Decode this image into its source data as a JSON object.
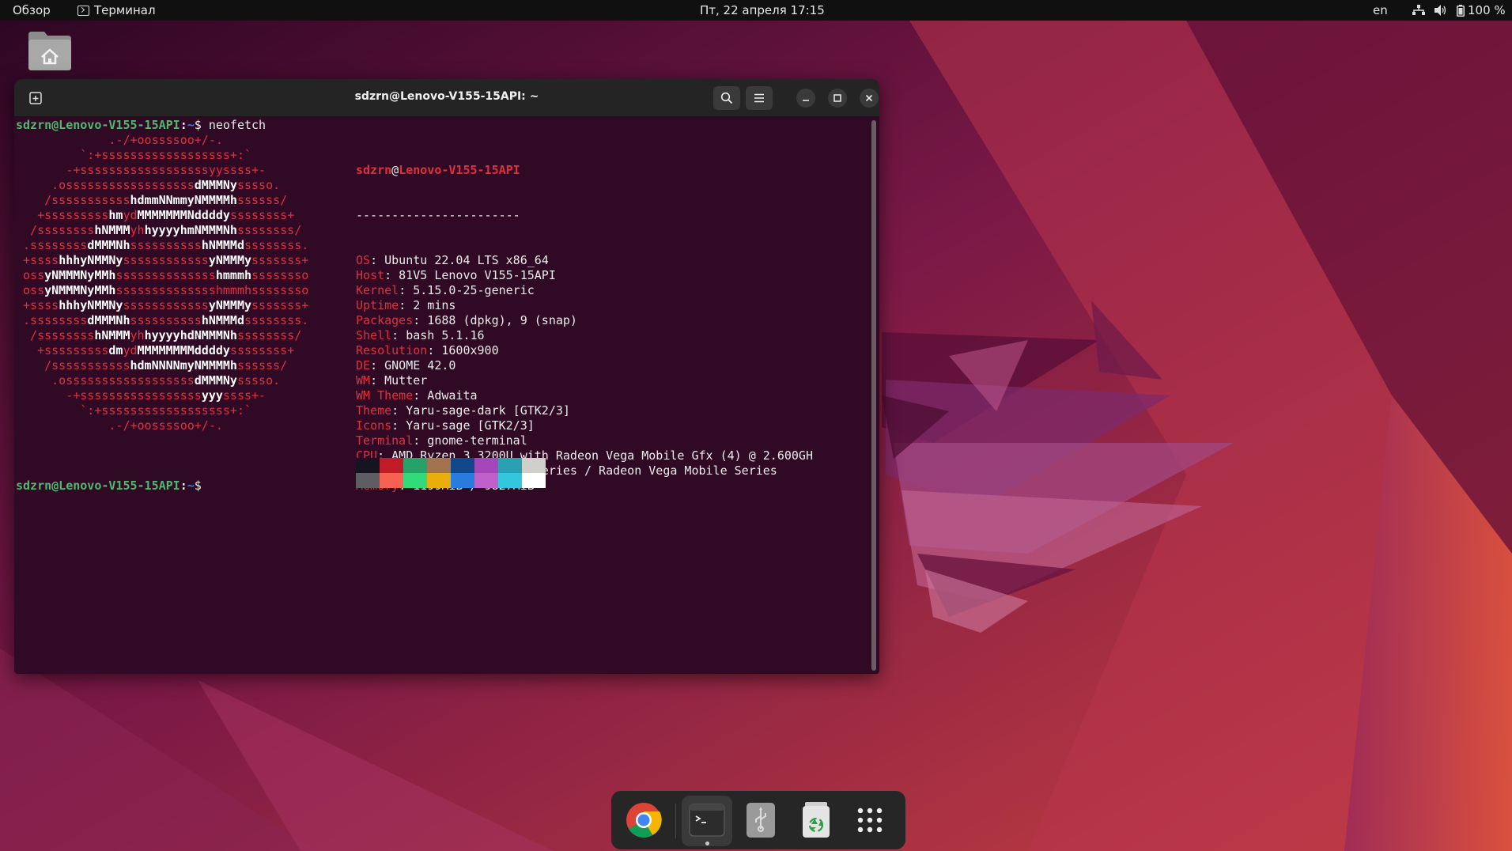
{
  "topbar": {
    "activities": "Обзор",
    "app_name": "Терминал",
    "clock": "Пт, 22 апреля  17:15",
    "language": "en",
    "battery": "100 %"
  },
  "window": {
    "title": "sdzrn@Lenovo-V155-15API: ~"
  },
  "terminal": {
    "prompt_user": "sdzrn@Lenovo-V155-15API",
    "prompt_sep": ":",
    "prompt_path": "~",
    "prompt_dollar": "$",
    "command": " neofetch",
    "logo_lines": [
      [
        [
          "r",
          "             .-/+oossssoo+/-."
        ]
      ],
      [
        [
          "r",
          "         `:+ssssssssssssssssss+:`"
        ]
      ],
      [
        [
          "r",
          "       -+ssssssssssssssssssyyssss+-"
        ]
      ],
      [
        [
          "r",
          "     .ossssssssssssssssss"
        ],
        [
          "w",
          "dMMMNy"
        ],
        [
          "r",
          "sssso."
        ]
      ],
      [
        [
          "r",
          "    /sssssssssss"
        ],
        [
          "w",
          "hdmmNNmmyNMMMMh"
        ],
        [
          "r",
          "ssssss/"
        ]
      ],
      [
        [
          "r",
          "   +sssssssss"
        ],
        [
          "w",
          "hm"
        ],
        [
          "r",
          "yd"
        ],
        [
          "w",
          "MMMMMMMNddddy"
        ],
        [
          "r",
          "ssssssss+"
        ]
      ],
      [
        [
          "r",
          "  /ssssssss"
        ],
        [
          "w",
          "hNMMM"
        ],
        [
          "r",
          "yh"
        ],
        [
          "w",
          "hyyyyhmNMMMNh"
        ],
        [
          "r",
          "ssssssss/"
        ]
      ],
      [
        [
          "r",
          " .ssssssss"
        ],
        [
          "w",
          "dMMMNh"
        ],
        [
          "r",
          "ssssssssss"
        ],
        [
          "w",
          "hNMMMd"
        ],
        [
          "r",
          "ssssssss."
        ]
      ],
      [
        [
          "r",
          " +ssss"
        ],
        [
          "w",
          "hhhyNMMNy"
        ],
        [
          "r",
          "ssssssssssss"
        ],
        [
          "w",
          "yNMMMy"
        ],
        [
          "r",
          "sssssss+"
        ]
      ],
      [
        [
          "r",
          " oss"
        ],
        [
          "w",
          "yNMMMNyMMh"
        ],
        [
          "r",
          "ssssssssssssss"
        ],
        [
          "w",
          "hmmmh"
        ],
        [
          "r",
          "ssssssso"
        ]
      ],
      [
        [
          "r",
          " oss"
        ],
        [
          "w",
          "yNMMMNyMMh"
        ],
        [
          "r",
          "sssssssssssssshmmmhssssssso"
        ]
      ],
      [
        [
          "r",
          " +ssss"
        ],
        [
          "w",
          "hhhyNMMNy"
        ],
        [
          "r",
          "ssssssssssss"
        ],
        [
          "w",
          "yNMMMy"
        ],
        [
          "r",
          "sssssss+"
        ]
      ],
      [
        [
          "r",
          " .ssssssss"
        ],
        [
          "w",
          "dMMMNh"
        ],
        [
          "r",
          "ssssssssss"
        ],
        [
          "w",
          "hNMMMd"
        ],
        [
          "r",
          "ssssssss."
        ]
      ],
      [
        [
          "r",
          "  /ssssssss"
        ],
        [
          "w",
          "hNMMM"
        ],
        [
          "r",
          "yh"
        ],
        [
          "w",
          "hyyyyhdNMMMNh"
        ],
        [
          "r",
          "ssssssss/"
        ]
      ],
      [
        [
          "r",
          "   +sssssssss"
        ],
        [
          "w",
          "dm"
        ],
        [
          "r",
          "yd"
        ],
        [
          "w",
          "MMMMMMMMddddy"
        ],
        [
          "r",
          "ssssssss+"
        ]
      ],
      [
        [
          "r",
          "    /sssssssssss"
        ],
        [
          "w",
          "hdmNNNNmyNMMMMh"
        ],
        [
          "r",
          "ssssss/"
        ]
      ],
      [
        [
          "r",
          "     .ossssssssssssssssss"
        ],
        [
          "w",
          "dMMMNy"
        ],
        [
          "r",
          "sssso."
        ]
      ],
      [
        [
          "r",
          "       -+sssssssssssssssss"
        ],
        [
          "w",
          "yyy"
        ],
        [
          "r",
          "ssss+-"
        ]
      ],
      [
        [
          "r",
          "         `:+ssssssssssssssssss+:`"
        ]
      ],
      [
        [
          "r",
          "             .-/+oossssoo+/-."
        ]
      ]
    ],
    "info_user": "sdzrn",
    "info_at": "@",
    "info_host": "Lenovo-V155-15API",
    "info_separator": "-----------------------",
    "info_lines": [
      {
        "key": "OS",
        "value": ": Ubuntu 22.04 LTS x86_64"
      },
      {
        "key": "Host",
        "value": ": 81V5 Lenovo V155-15API"
      },
      {
        "key": "Kernel",
        "value": ": 5.15.0-25-generic"
      },
      {
        "key": "Uptime",
        "value": ": 2 mins"
      },
      {
        "key": "Packages",
        "value": ": 1688 (dpkg), 9 (snap)"
      },
      {
        "key": "Shell",
        "value": ": bash 5.1.16"
      },
      {
        "key": "Resolution",
        "value": ": 1600x900"
      },
      {
        "key": "DE",
        "value": ": GNOME 42.0"
      },
      {
        "key": "WM",
        "value": ": Mutter"
      },
      {
        "key": "WM Theme",
        "value": ": Adwaita"
      },
      {
        "key": "Theme",
        "value": ": Yaru-sage-dark [GTK2/3]"
      },
      {
        "key": "Icons",
        "value": ": Yaru-sage [GTK2/3]"
      },
      {
        "key": "Terminal",
        "value": ": gnome-terminal"
      },
      {
        "key": "CPU",
        "value": ": AMD Ryzen 3 3200U with Radeon Vega Mobile Gfx (4) @ 2.600GH"
      },
      {
        "key": "GPU",
        "value": ": AMD ATI Radeon Vega Series / Radeon Vega Mobile Series"
      },
      {
        "key": "Memory",
        "value": ": 1199MiB / 9827MiB"
      }
    ],
    "palette_top": [
      "#171421",
      "#c01c28",
      "#26a269",
      "#a2734c",
      "#12488b",
      "#a347ba",
      "#2aa1b3",
      "#d0cfcc"
    ],
    "palette_bottom": [
      "#5e5c64",
      "#f66151",
      "#33da7a",
      "#e9ad0c",
      "#2a7bde",
      "#c061cb",
      "#33c7de",
      "#ffffff"
    ]
  },
  "dock": {
    "items": [
      "chrome-icon",
      "terminal-icon",
      "usb-drive-icon",
      "trash-icon",
      "app-grid-icon"
    ]
  },
  "colors": {
    "terminal_bg": "#300a24",
    "prompt_green": "#4eba6f",
    "accent_red": "#e03040"
  }
}
